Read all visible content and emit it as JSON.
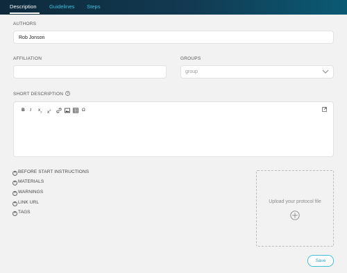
{
  "tabs": [
    {
      "label": "Description",
      "active": true
    },
    {
      "label": "Guidelines",
      "active": false
    },
    {
      "label": "Steps",
      "active": false
    }
  ],
  "authors": {
    "label": "AUTHORS",
    "value": "Rob Jonson"
  },
  "affiliation": {
    "label": "AFFILIATION",
    "value": ""
  },
  "groups": {
    "label": "GROUPS",
    "value": "group"
  },
  "short_description": {
    "label": "SHORT DESCRIPTION",
    "help_icon": "help-circle-icon"
  },
  "editor_toolbar": {
    "bold": "B",
    "italic": "I",
    "subscript": "x",
    "subscript_mark": "2",
    "superscript": "x",
    "superscript_mark": "2",
    "omega": "Ω"
  },
  "sections": [
    {
      "label": "BEFORE START INSTRUCTIONS"
    },
    {
      "label": "MATERIALS"
    },
    {
      "label": "WARNINGS"
    },
    {
      "label": "LINK URL"
    },
    {
      "label": "TAGS"
    }
  ],
  "upload": {
    "label": "Upload your protocol file"
  },
  "save_label": "Save",
  "colors": {
    "accent": "#3fbfdc",
    "topbar": "#0e2a3c"
  }
}
